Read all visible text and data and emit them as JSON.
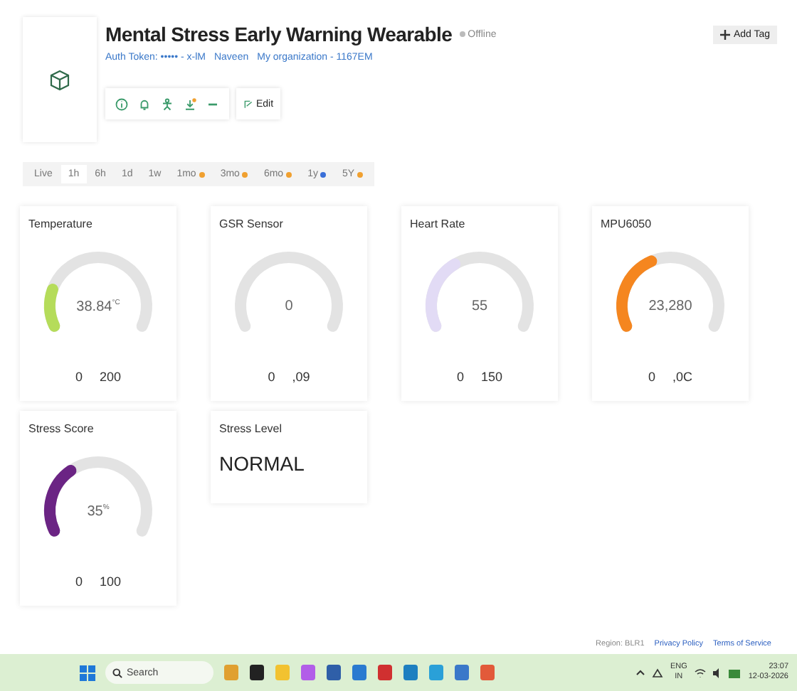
{
  "device": {
    "title": "Mental Stress Early Warning Wearable",
    "status": "Offline",
    "online": false,
    "auth_token": "Auth Token: ••••• - x-lM",
    "owner": "Naveen",
    "organization": "My organization - 1167EM"
  },
  "toolbar": {
    "edit_label": "Edit",
    "download_alert": true
  },
  "add_tag": "Add Tag",
  "time_tabs": [
    {
      "label": "Live",
      "selected": false
    },
    {
      "label": "1h",
      "selected": true
    },
    {
      "label": "6h",
      "selected": false
    },
    {
      "label": "1d",
      "selected": false
    },
    {
      "label": "1w",
      "selected": false
    },
    {
      "label": "1mo",
      "selected": false,
      "color": "#f0a030"
    },
    {
      "label": "3mo",
      "selected": false,
      "color": "#f0a030"
    },
    {
      "label": "6mo",
      "selected": false,
      "color": "#f0a030"
    },
    {
      "label": "1y",
      "selected": false,
      "color": "#3a6fd8"
    },
    {
      "label": "5Y",
      "selected": false,
      "color": "#f0a030"
    }
  ],
  "widgets": [
    {
      "kind": "gauge",
      "title": "Temperature",
      "value": "38.84",
      "unit": "°C",
      "min": "0",
      "max": "200",
      "color": "#b5dc5a"
    },
    {
      "kind": "gauge",
      "title": "GSR Sensor",
      "value": "0",
      "min": "0",
      "max": ",09"
    },
    {
      "kind": "gauge",
      "title": "Heart Rate",
      "value": "55",
      "min": "0",
      "max": "150",
      "color": "#e2dbf5"
    },
    {
      "kind": "gauge",
      "title": "MPU6050",
      "value": "23,280",
      "min": "0",
      "max": ",0C",
      "color": "#f5861f"
    },
    {
      "kind": "gauge",
      "title": "Stress Score",
      "value": "35",
      "unit": "%",
      "min": "0",
      "max": "100",
      "color": "#6b2484"
    },
    {
      "kind": "label",
      "title": "Stress Level",
      "value": "NORMAL"
    }
  ],
  "footer": {
    "region": "Region: BLR1",
    "links": [
      "Privacy Policy",
      "Terms of Service"
    ]
  },
  "taskbar": {
    "search_placeholder": "Search",
    "language": "ENG",
    "region": "IN",
    "time": "23:07",
    "date": "12-03-2026"
  }
}
